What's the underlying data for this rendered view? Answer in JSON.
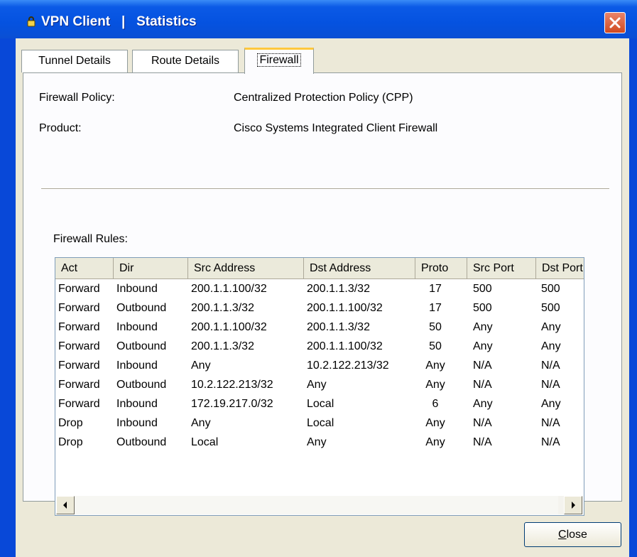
{
  "window": {
    "title": "VPN Client   |   Statistics",
    "close_icon": "close-icon",
    "app_icon": "lock-icon"
  },
  "tabs": [
    {
      "label": "Tunnel Details"
    },
    {
      "label": "Route Details"
    },
    {
      "label": "Firewall",
      "active": true
    }
  ],
  "info": {
    "policy_label": "Firewall Policy:",
    "policy_value": "Centralized Protection Policy (CPP)",
    "product_label": "Product:",
    "product_value": "Cisco Systems Integrated Client Firewall"
  },
  "rules": {
    "title": "Firewall Rules:",
    "columns": [
      "Act",
      "Dir",
      "Src Address",
      "Dst Address",
      "Proto",
      "Src Port",
      "Dst Port"
    ],
    "rows": [
      [
        "Forward",
        "Inbound",
        "200.1.1.100/32",
        "200.1.1.3/32",
        "17",
        "500",
        "500"
      ],
      [
        "Forward",
        "Outbound",
        "200.1.1.3/32",
        "200.1.1.100/32",
        "17",
        "500",
        "500"
      ],
      [
        "Forward",
        "Inbound",
        "200.1.1.100/32",
        "200.1.1.3/32",
        "50",
        "Any",
        "Any"
      ],
      [
        "Forward",
        "Outbound",
        "200.1.1.3/32",
        "200.1.1.100/32",
        "50",
        "Any",
        "Any"
      ],
      [
        "Forward",
        "Inbound",
        "Any",
        "10.2.122.213/32",
        "Any",
        "N/A",
        "N/A"
      ],
      [
        "Forward",
        "Outbound",
        "10.2.122.213/32",
        "Any",
        "Any",
        "N/A",
        "N/A"
      ],
      [
        "Forward",
        "Inbound",
        "172.19.217.0/32",
        "Local",
        "6",
        "Any",
        "Any"
      ],
      [
        "Drop",
        "Inbound",
        "Any",
        "Local",
        "Any",
        "N/A",
        "N/A"
      ],
      [
        "Drop",
        "Outbound",
        "Local",
        "Any",
        "Any",
        "N/A",
        "N/A"
      ]
    ]
  },
  "footer": {
    "close_label_underlined": "C",
    "close_label_rest": "lose"
  },
  "colors": {
    "titlebar": "#0552e0",
    "face": "#ece9d8",
    "tab_highlight": "#ffc83c"
  }
}
